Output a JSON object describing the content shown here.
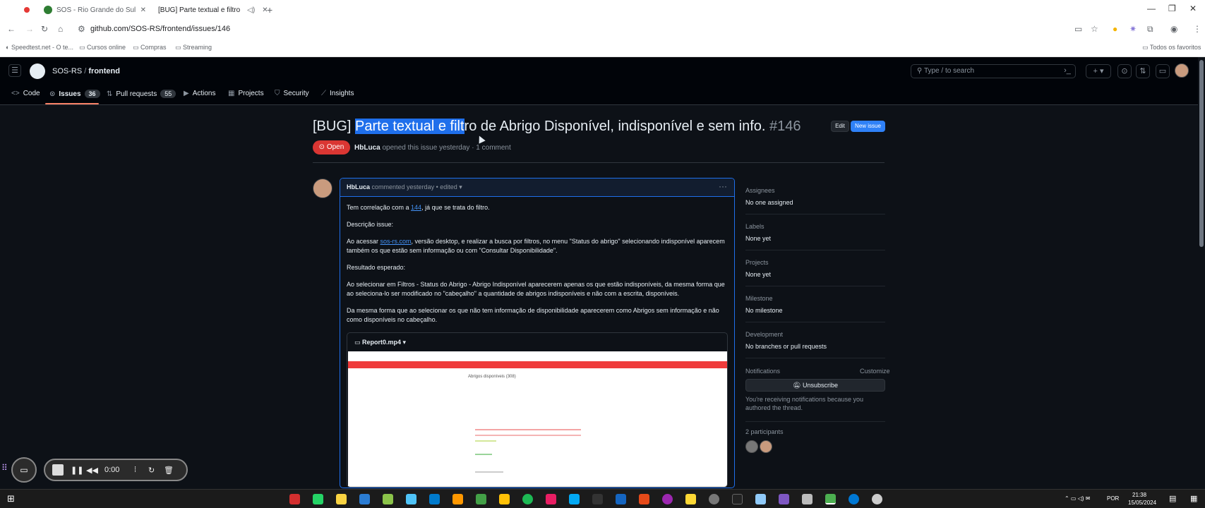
{
  "browser": {
    "tabs": [
      {
        "title": "SOS - Rio Grande do Sul",
        "icon": "brazil-flag-icon"
      },
      {
        "title": "[BUG] Parte textual e filtro",
        "icon": "github-icon"
      }
    ],
    "url": "github.com/SOS-RS/frontend/issues/146",
    "bookmarks": [
      "Speedtest.net - O te...",
      "Cursos online",
      "Compras",
      "Streaming"
    ],
    "all_bookmarks": "Todos os favoritos"
  },
  "header": {
    "owner": "SOS-RS",
    "separator": "/",
    "repo": "frontend",
    "search_placeholder": "Type / to search"
  },
  "repo_nav": {
    "code": "Code",
    "issues": "Issues",
    "issues_count": "36",
    "pulls": "Pull requests",
    "pulls_count": "55",
    "actions": "Actions",
    "projects": "Projects",
    "security": "Security",
    "insights": "Insights"
  },
  "issue": {
    "title_prefix": "[BUG] ",
    "title_selected": "Parte textual e filt",
    "title_rest": "ro de Abrigo Disponível, indisponível e sem info.",
    "number": "#146",
    "edit_label": "Edit",
    "new_issue_label": "New issue",
    "status": "Open",
    "author": "HbLuca",
    "opened_text": "opened this issue yesterday · 1 comment"
  },
  "comment": {
    "author": "HbLuca",
    "meta": "commented yesterday • edited",
    "p1_before": "Tem correlação com a ",
    "p1_link": "144",
    "p1_after": ", já que se trata do filtro.",
    "p2": "Descrição issue:",
    "p3_before": "Ao acessar ",
    "p3_link": "sos-rs.com",
    "p3_after": ", versão desktop, e realizar a busca por filtros, no menu \"Status do abrigo\" selecionando indisponível aparecem também os que estão sem informação ou com \"Consultar Disponibilidade\".",
    "p4": "Resultado esperado:",
    "p5": "Ao selecionar em Filtros - Status do Abrigo - Abrigo Indisponível aparecerem apenas os que estão indisponíveis, da mesma forma que ao seleciona-lo ser modificado no \"cabeçalho\" a quantidade de abrigos indisponíveis e não com a escrita, disponíveis.",
    "p6": "Da mesma forma que ao selecionar os que não tem informação de disponibilidade aparecerem como Abrigos sem informação e não como disponíveis no cabeçalho.",
    "video_name": "Report0.mp4",
    "video_page_title": "Abrigos disponíveis (308)"
  },
  "sidebar": {
    "assignees_h": "Assignees",
    "assignees_v": "No one assigned",
    "labels_h": "Labels",
    "labels_v": "None yet",
    "projects_h": "Projects",
    "projects_v": "None yet",
    "milestone_h": "Milestone",
    "milestone_v": "No milestone",
    "development_h": "Development",
    "development_v": "No branches or pull requests",
    "notifications_h": "Notifications",
    "customize": "Customize",
    "unsubscribe": "Unsubscribe",
    "notif_text": "You're receiving notifications because you authored the thread.",
    "participants_h": "2 participants"
  },
  "recorder": {
    "time": "0:00"
  },
  "taskbar": {
    "lang": "POR",
    "time": "21:38",
    "date": "15/05/2024"
  },
  "colors": {
    "accent": "#2f81f7",
    "open": "#da3633",
    "selection": "#1f6feb",
    "tab_underline": "#f78166"
  }
}
